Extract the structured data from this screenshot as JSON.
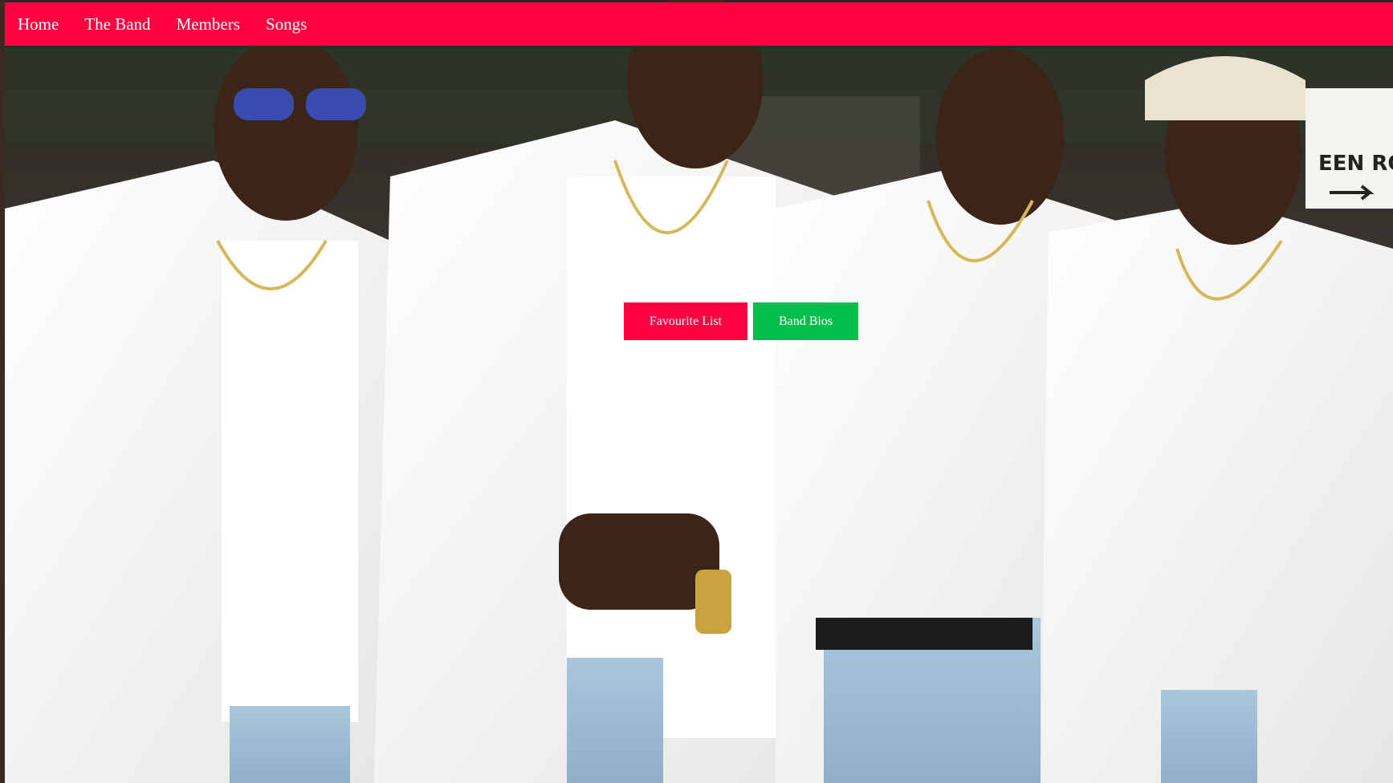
{
  "nav": {
    "items": [
      {
        "label": "Home"
      },
      {
        "label": "The Band"
      },
      {
        "label": "Members"
      },
      {
        "label": "Songs"
      }
    ],
    "color": "#ff0040"
  },
  "actions": {
    "favourite_label": "Favourite List",
    "favourite_color": "#ff0040",
    "bios_label": "Band Bios",
    "bios_color": "#00c04b"
  },
  "hero": {
    "sign_text": "EEN ROOM",
    "icons": [
      "arrow-right-icon"
    ]
  }
}
